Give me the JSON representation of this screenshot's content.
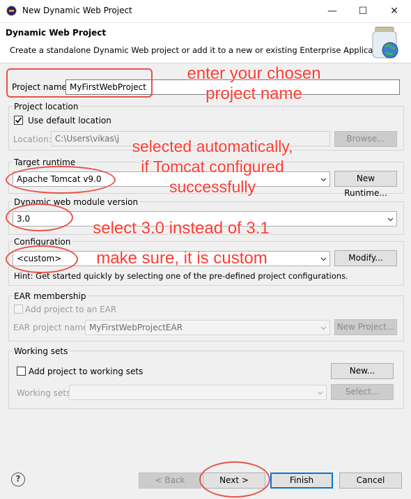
{
  "window": {
    "title": "New Dynamic Web Project",
    "controls": {
      "minimize": "—",
      "maximize": "☐",
      "close": "✕"
    }
  },
  "header": {
    "title": "Dynamic Web Project",
    "description": "Create a standalone Dynamic Web project or add it to a new or existing Enterprise Application."
  },
  "project_name": {
    "label": "Project name:",
    "value": "MyFirstWebProject"
  },
  "project_location": {
    "group_label": "Project location",
    "use_default_label": "Use default location",
    "use_default_checked": true,
    "location_label": "Location:",
    "location_value": "C:\\Users\\vikas\\j",
    "browse_label": "Browse..."
  },
  "target_runtime": {
    "group_label": "Target runtime",
    "value": "Apache Tomcat v9.0",
    "new_runtime_label": "New Runtime..."
  },
  "module_version": {
    "group_label": "Dynamic web module version",
    "value": "3.0"
  },
  "configuration": {
    "group_label": "Configuration",
    "value": "<custom>",
    "modify_label": "Modify...",
    "hint": "Hint: Get started quickly by selecting one of the pre-defined project configurations."
  },
  "ear": {
    "group_label": "EAR membership",
    "add_label": "Add project to an EAR",
    "project_name_label": "EAR project name:",
    "project_name_value": "MyFirstWebProjectEAR",
    "new_project_label": "New Project..."
  },
  "working_sets": {
    "group_label": "Working sets",
    "add_label": "Add project to working sets",
    "new_label": "New...",
    "sets_label": "Working sets:",
    "select_label": "Select..."
  },
  "footer": {
    "help": "?",
    "back": "< Back",
    "next": "Next >",
    "finish": "Finish",
    "cancel": "Cancel"
  },
  "annotations": {
    "project_name": "enter your chosen\nproject name",
    "runtime": "selected automatically,\nif Tomcat configured\nsuccessfully",
    "version": "select 3.0 instead of 3.1",
    "configuration": "make sure, it is custom",
    "color": "#ff3b30"
  }
}
